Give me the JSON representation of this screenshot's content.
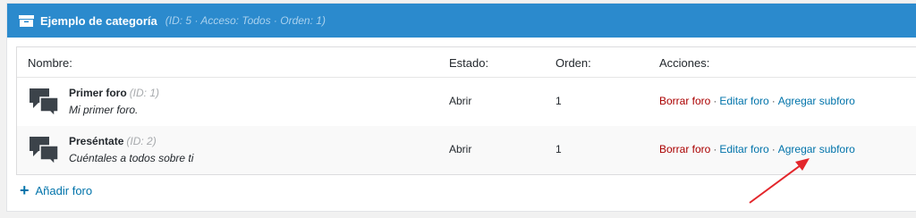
{
  "category": {
    "title": "Ejemplo de categoría",
    "meta": "(ID: 5 · Acceso: Todos · Orden: 1)"
  },
  "columns": {
    "name": "Nombre:",
    "state": "Estado:",
    "order": "Orden:",
    "actions": "Acciones:"
  },
  "forums": [
    {
      "name": "Primer foro",
      "id": "(ID: 1)",
      "description": "Mi primer foro.",
      "state": "Abrir",
      "order": "1",
      "delete_label": "Borrar foro",
      "edit_label": "Editar foro",
      "add_sub_label": "Agregar subforo"
    },
    {
      "name": "Preséntate",
      "id": "(ID: 2)",
      "description": "Cuéntales a todos sobre ti",
      "state": "Abrir",
      "order": "1",
      "delete_label": "Borrar foro",
      "edit_label": "Editar foro",
      "add_sub_label": "Agregar subforo"
    }
  ],
  "separator": "·",
  "add_forum_label": "Añadir foro",
  "colors": {
    "header": "#2b8acd",
    "link": "#0073aa",
    "delete": "#aa0000",
    "annotation_arrow": "#e3262b"
  }
}
